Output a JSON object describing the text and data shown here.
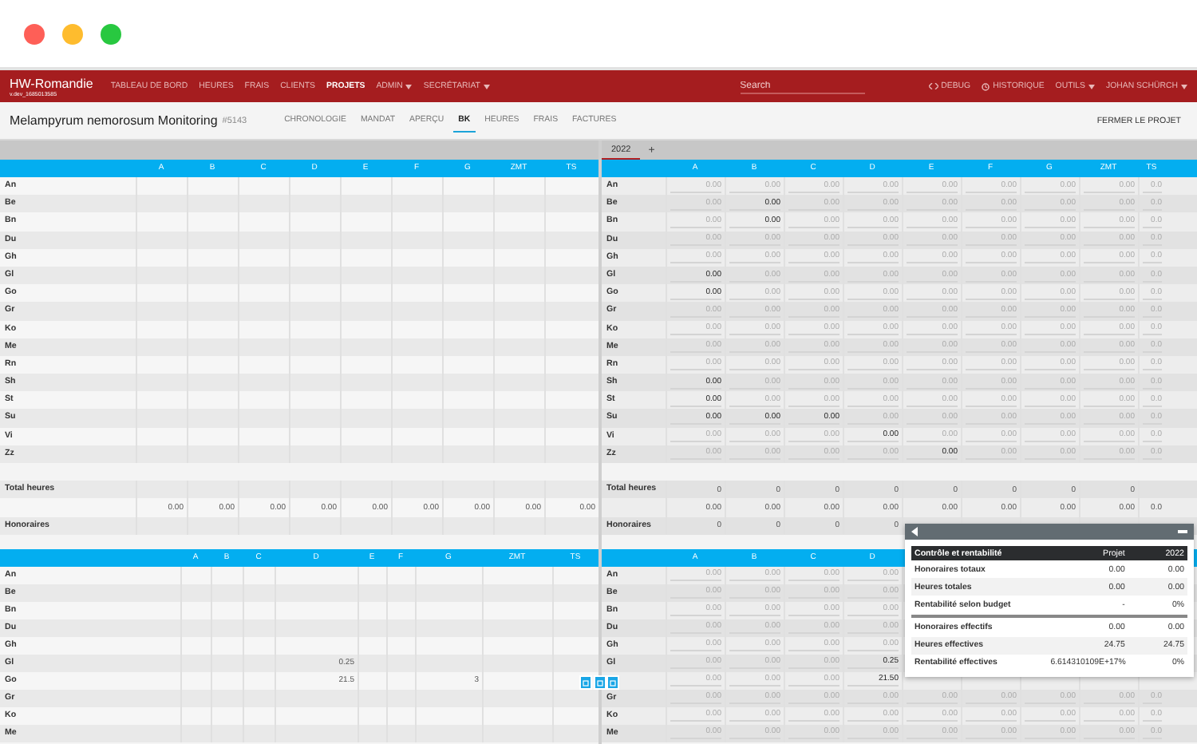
{
  "navbar": {
    "brand": "HW-Romandie",
    "version": "v.dev_1685013585",
    "items": [
      {
        "label": "TABLEAU DE BORD",
        "selected": false,
        "dropdown": false
      },
      {
        "label": "HEURES",
        "selected": false,
        "dropdown": false
      },
      {
        "label": "FRAIS",
        "selected": false,
        "dropdown": false
      },
      {
        "label": "CLIENTS",
        "selected": false,
        "dropdown": false
      },
      {
        "label": "PROJETS",
        "selected": true,
        "dropdown": false
      },
      {
        "label": "ADMIN",
        "selected": false,
        "dropdown": true
      },
      {
        "label": "SECRÉTARIAT",
        "selected": false,
        "dropdown": true
      }
    ],
    "search": {
      "placeholder": "Search"
    },
    "right_items": [
      {
        "label": "DEBUG",
        "kind": "code"
      },
      {
        "label": "HISTORIQUE",
        "kind": "history"
      },
      {
        "label": "OUTILS",
        "kind": "dropdown"
      },
      {
        "label": "JOHAN SCHÜRCH",
        "kind": "dropdown"
      }
    ]
  },
  "project": {
    "title": "Melampyrum nemorosum Monitoring",
    "number": "#5143",
    "tabs": [
      {
        "label": "CHRONOLOGIE",
        "selected": false
      },
      {
        "label": "MANDAT",
        "selected": false
      },
      {
        "label": "APERÇU",
        "selected": false
      },
      {
        "label": "BK",
        "selected": true
      },
      {
        "label": "HEURES",
        "selected": false
      },
      {
        "label": "FRAIS",
        "selected": false
      },
      {
        "label": "FACTURES",
        "selected": false
      }
    ],
    "close_button": "FERMER LE PROJET"
  },
  "left": {
    "top_table": {
      "columns": [
        "A",
        "B",
        "C",
        "D",
        "E",
        "F",
        "G",
        "ZMT",
        "TS"
      ],
      "rows": [
        {
          "kind": "plain",
          "label": "An"
        },
        {
          "kind": "plain",
          "label": "Be"
        },
        {
          "kind": "plain",
          "label": "Bn"
        },
        {
          "kind": "plain",
          "label": "Du"
        },
        {
          "kind": "plain",
          "label": "Gh"
        },
        {
          "kind": "plain",
          "label": "Gl"
        },
        {
          "kind": "plain",
          "label": "Go"
        },
        {
          "kind": "plain",
          "label": "Gr"
        },
        {
          "kind": "plain",
          "label": "Ko"
        },
        {
          "kind": "plain",
          "label": "Me"
        },
        {
          "kind": "plain",
          "label": "Rn"
        },
        {
          "kind": "plain",
          "label": "Sh"
        },
        {
          "kind": "plain",
          "label": "St"
        },
        {
          "kind": "plain",
          "label": "Su"
        },
        {
          "kind": "plain",
          "label": "Vi"
        },
        {
          "kind": "plain",
          "label": "Zz"
        },
        {
          "kind": "spacer"
        },
        {
          "kind": "plain",
          "label": "Total heures"
        },
        {
          "kind": "plain",
          "cells": [
            {
              "text": "0.00"
            },
            {
              "text": "0.00"
            },
            {
              "text": "0.00"
            },
            {
              "text": "0.00"
            },
            {
              "text": "0.00"
            },
            {
              "text": "0.00"
            },
            {
              "text": "0.00"
            },
            {
              "text": "0.00"
            },
            {
              "text": "0.00"
            }
          ]
        },
        {
          "kind": "plain",
          "label": "Honoraires"
        }
      ]
    },
    "bottom_table": {
      "columns": [
        "A",
        "B",
        "C",
        "D",
        "E",
        "F",
        "G",
        "ZMT",
        "TS"
      ],
      "rows": [
        {
          "kind": "plain",
          "label": "An"
        },
        {
          "kind": "plain",
          "label": "Be"
        },
        {
          "kind": "plain",
          "label": "Bn"
        },
        {
          "kind": "plain",
          "label": "Du"
        },
        {
          "kind": "plain",
          "label": "Gh"
        },
        {
          "kind": "plain",
          "label": "Gl",
          "cells": [
            null,
            null,
            null,
            {
              "text": "0.25"
            }
          ]
        },
        {
          "kind": "plain",
          "label": "Go",
          "cells": [
            null,
            null,
            null,
            {
              "text": "21.5"
            },
            null,
            null,
            {
              "text": "3"
            }
          ]
        },
        {
          "kind": "plain",
          "label": "Gr"
        },
        {
          "kind": "plain",
          "label": "Ko"
        },
        {
          "kind": "plain",
          "label": "Me"
        }
      ]
    }
  },
  "right": {
    "year_tabs": [
      {
        "label": "2022",
        "selected": true
      }
    ],
    "add_tab": "+",
    "top_table": {
      "columns": [
        "A",
        "B",
        "C",
        "D",
        "E",
        "F",
        "G",
        "ZMT",
        "TS"
      ],
      "rows": [
        {
          "kind": "input",
          "label": "An",
          "cells": [
            {
              "text": "0.00",
              "entered": false
            },
            {
              "text": "0.00",
              "entered": false
            },
            {
              "text": "0.00",
              "entered": false
            },
            {
              "text": "0.00",
              "entered": false
            },
            {
              "text": "0.00",
              "entered": false
            },
            {
              "text": "0.00",
              "entered": false
            },
            {
              "text": "0.00",
              "entered": false
            },
            {
              "text": "0.00",
              "entered": false
            },
            {
              "text": "0.0",
              "entered": false
            }
          ]
        },
        {
          "kind": "input",
          "label": "Be",
          "cells": [
            {
              "text": "0.00",
              "entered": false
            },
            {
              "text": "0.00",
              "entered": true
            },
            {
              "text": "0.00",
              "entered": false
            },
            {
              "text": "0.00",
              "entered": false
            },
            {
              "text": "0.00",
              "entered": false
            },
            {
              "text": "0.00",
              "entered": false
            },
            {
              "text": "0.00",
              "entered": false
            },
            {
              "text": "0.00",
              "entered": false
            },
            {
              "text": "0.0",
              "entered": false
            }
          ]
        },
        {
          "kind": "input",
          "label": "Bn",
          "cells": [
            {
              "text": "0.00",
              "entered": false
            },
            {
              "text": "0.00",
              "entered": true
            },
            {
              "text": "0.00",
              "entered": false
            },
            {
              "text": "0.00",
              "entered": false
            },
            {
              "text": "0.00",
              "entered": false
            },
            {
              "text": "0.00",
              "entered": false
            },
            {
              "text": "0.00",
              "entered": false
            },
            {
              "text": "0.00",
              "entered": false
            },
            {
              "text": "0.0",
              "entered": false
            }
          ]
        },
        {
          "kind": "input",
          "label": "Du",
          "cells": [
            {
              "text": "0.00",
              "entered": false
            },
            {
              "text": "0.00",
              "entered": false
            },
            {
              "text": "0.00",
              "entered": false
            },
            {
              "text": "0.00",
              "entered": false
            },
            {
              "text": "0.00",
              "entered": false
            },
            {
              "text": "0.00",
              "entered": false
            },
            {
              "text": "0.00",
              "entered": false
            },
            {
              "text": "0.00",
              "entered": false
            },
            {
              "text": "0.0",
              "entered": false
            }
          ]
        },
        {
          "kind": "input",
          "label": "Gh",
          "cells": [
            {
              "text": "0.00",
              "entered": false
            },
            {
              "text": "0.00",
              "entered": false
            },
            {
              "text": "0.00",
              "entered": false
            },
            {
              "text": "0.00",
              "entered": false
            },
            {
              "text": "0.00",
              "entered": false
            },
            {
              "text": "0.00",
              "entered": false
            },
            {
              "text": "0.00",
              "entered": false
            },
            {
              "text": "0.00",
              "entered": false
            },
            {
              "text": "0.0",
              "entered": false
            }
          ]
        },
        {
          "kind": "input",
          "label": "Gl",
          "cells": [
            {
              "text": "0.00",
              "entered": true
            },
            {
              "text": "0.00",
              "entered": false
            },
            {
              "text": "0.00",
              "entered": false
            },
            {
              "text": "0.00",
              "entered": false
            },
            {
              "text": "0.00",
              "entered": false
            },
            {
              "text": "0.00",
              "entered": false
            },
            {
              "text": "0.00",
              "entered": false
            },
            {
              "text": "0.00",
              "entered": false
            },
            {
              "text": "0.0",
              "entered": false
            }
          ]
        },
        {
          "kind": "input",
          "label": "Go",
          "cells": [
            {
              "text": "0.00",
              "entered": true
            },
            {
              "text": "0.00",
              "entered": false
            },
            {
              "text": "0.00",
              "entered": false
            },
            {
              "text": "0.00",
              "entered": false
            },
            {
              "text": "0.00",
              "entered": false
            },
            {
              "text": "0.00",
              "entered": false
            },
            {
              "text": "0.00",
              "entered": false
            },
            {
              "text": "0.00",
              "entered": false
            },
            {
              "text": "0.0",
              "entered": false
            }
          ]
        },
        {
          "kind": "input",
          "label": "Gr",
          "cells": [
            {
              "text": "0.00",
              "entered": false
            },
            {
              "text": "0.00",
              "entered": false
            },
            {
              "text": "0.00",
              "entered": false
            },
            {
              "text": "0.00",
              "entered": false
            },
            {
              "text": "0.00",
              "entered": false
            },
            {
              "text": "0.00",
              "entered": false
            },
            {
              "text": "0.00",
              "entered": false
            },
            {
              "text": "0.00",
              "entered": false
            },
            {
              "text": "0.0",
              "entered": false
            }
          ]
        },
        {
          "kind": "input",
          "label": "Ko",
          "cells": [
            {
              "text": "0.00",
              "entered": false
            },
            {
              "text": "0.00",
              "entered": false
            },
            {
              "text": "0.00",
              "entered": false
            },
            {
              "text": "0.00",
              "entered": false
            },
            {
              "text": "0.00",
              "entered": false
            },
            {
              "text": "0.00",
              "entered": false
            },
            {
              "text": "0.00",
              "entered": false
            },
            {
              "text": "0.00",
              "entered": false
            },
            {
              "text": "0.0",
              "entered": false
            }
          ]
        },
        {
          "kind": "input",
          "label": "Me",
          "cells": [
            {
              "text": "0.00",
              "entered": false
            },
            {
              "text": "0.00",
              "entered": false
            },
            {
              "text": "0.00",
              "entered": false
            },
            {
              "text": "0.00",
              "entered": false
            },
            {
              "text": "0.00",
              "entered": false
            },
            {
              "text": "0.00",
              "entered": false
            },
            {
              "text": "0.00",
              "entered": false
            },
            {
              "text": "0.00",
              "entered": false
            },
            {
              "text": "0.0",
              "entered": false
            }
          ]
        },
        {
          "kind": "input",
          "label": "Rn",
          "cells": [
            {
              "text": "0.00",
              "entered": false
            },
            {
              "text": "0.00",
              "entered": false
            },
            {
              "text": "0.00",
              "entered": false
            },
            {
              "text": "0.00",
              "entered": false
            },
            {
              "text": "0.00",
              "entered": false
            },
            {
              "text": "0.00",
              "entered": false
            },
            {
              "text": "0.00",
              "entered": false
            },
            {
              "text": "0.00",
              "entered": false
            },
            {
              "text": "0.0",
              "entered": false
            }
          ]
        },
        {
          "kind": "input",
          "label": "Sh",
          "cells": [
            {
              "text": "0.00",
              "entered": true
            },
            {
              "text": "0.00",
              "entered": false
            },
            {
              "text": "0.00",
              "entered": false
            },
            {
              "text": "0.00",
              "entered": false
            },
            {
              "text": "0.00",
              "entered": false
            },
            {
              "text": "0.00",
              "entered": false
            },
            {
              "text": "0.00",
              "entered": false
            },
            {
              "text": "0.00",
              "entered": false
            },
            {
              "text": "0.0",
              "entered": false
            }
          ]
        },
        {
          "kind": "input",
          "label": "St",
          "cells": [
            {
              "text": "0.00",
              "entered": true
            },
            {
              "text": "0.00",
              "entered": false
            },
            {
              "text": "0.00",
              "entered": false
            },
            {
              "text": "0.00",
              "entered": false
            },
            {
              "text": "0.00",
              "entered": false
            },
            {
              "text": "0.00",
              "entered": false
            },
            {
              "text": "0.00",
              "entered": false
            },
            {
              "text": "0.00",
              "entered": false
            },
            {
              "text": "0.0",
              "entered": false
            }
          ]
        },
        {
          "kind": "input",
          "label": "Su",
          "cells": [
            {
              "text": "0.00",
              "entered": true
            },
            {
              "text": "0.00",
              "entered": true
            },
            {
              "text": "0.00",
              "entered": true
            },
            {
              "text": "0.00",
              "entered": false
            },
            {
              "text": "0.00",
              "entered": false
            },
            {
              "text": "0.00",
              "entered": false
            },
            {
              "text": "0.00",
              "entered": false
            },
            {
              "text": "0.00",
              "entered": false
            },
            {
              "text": "0.0",
              "entered": false
            }
          ]
        },
        {
          "kind": "input",
          "label": "Vi",
          "cells": [
            {
              "text": "0.00",
              "entered": false
            },
            {
              "text": "0.00",
              "entered": false
            },
            {
              "text": "0.00",
              "entered": false
            },
            {
              "text": "0.00",
              "entered": true
            },
            {
              "text": "0.00",
              "entered": false
            },
            {
              "text": "0.00",
              "entered": false
            },
            {
              "text": "0.00",
              "entered": false
            },
            {
              "text": "0.00",
              "entered": false
            },
            {
              "text": "0.0",
              "entered": false
            }
          ]
        },
        {
          "kind": "input",
          "label": "Zz",
          "cells": [
            {
              "text": "0.00",
              "entered": false
            },
            {
              "text": "0.00",
              "entered": false
            },
            {
              "text": "0.00",
              "entered": false
            },
            {
              "text": "0.00",
              "entered": false
            },
            {
              "text": "0.00",
              "entered": true
            },
            {
              "text": "0.00",
              "entered": false
            },
            {
              "text": "0.00",
              "entered": false
            },
            {
              "text": "0.00",
              "entered": false
            },
            {
              "text": "0.0",
              "entered": false
            }
          ]
        },
        {
          "kind": "spacer"
        },
        {
          "kind": "plain",
          "label": "Total heures",
          "cells": [
            {
              "text": "0"
            },
            {
              "text": "0"
            },
            {
              "text": "0"
            },
            {
              "text": "0"
            },
            {
              "text": "0"
            },
            {
              "text": "0"
            },
            {
              "text": "0"
            },
            {
              "text": "0"
            }
          ]
        },
        {
          "kind": "plain",
          "cells": [
            {
              "text": "0.00"
            },
            {
              "text": "0.00"
            },
            {
              "text": "0.00"
            },
            {
              "text": "0.00"
            },
            {
              "text": "0.00"
            },
            {
              "text": "0.00"
            },
            {
              "text": "0.00"
            },
            {
              "text": "0.00"
            },
            {
              "text": "0.0"
            }
          ]
        },
        {
          "kind": "plain",
          "label": "Honoraires",
          "cells": [
            {
              "text": "0"
            },
            {
              "text": "0"
            },
            {
              "text": "0"
            },
            {
              "text": "0"
            }
          ]
        }
      ]
    },
    "bottom_table": {
      "columns": [
        "A",
        "B",
        "C",
        "D"
      ],
      "rows": [
        {
          "kind": "input",
          "label": "An",
          "cells": [
            {
              "text": "0.00",
              "entered": false
            },
            {
              "text": "0.00",
              "entered": false
            },
            {
              "text": "0.00",
              "entered": false
            },
            {
              "text": "0.00",
              "entered": false
            }
          ]
        },
        {
          "kind": "input",
          "label": "Be",
          "cells": [
            {
              "text": "0.00",
              "entered": false
            },
            {
              "text": "0.00",
              "entered": false
            },
            {
              "text": "0.00",
              "entered": false
            },
            {
              "text": "0.00",
              "entered": false
            }
          ]
        },
        {
          "kind": "input",
          "label": "Bn",
          "cells": [
            {
              "text": "0.00",
              "entered": false
            },
            {
              "text": "0.00",
              "entered": false
            },
            {
              "text": "0.00",
              "entered": false
            },
            {
              "text": "0.00",
              "entered": false
            }
          ]
        },
        {
          "kind": "input",
          "label": "Du",
          "cells": [
            {
              "text": "0.00",
              "entered": false
            },
            {
              "text": "0.00",
              "entered": false
            },
            {
              "text": "0.00",
              "entered": false
            },
            {
              "text": "0.00",
              "entered": false
            }
          ]
        },
        {
          "kind": "input",
          "label": "Gh",
          "cells": [
            {
              "text": "0.00",
              "entered": false
            },
            {
              "text": "0.00",
              "entered": false
            },
            {
              "text": "0.00",
              "entered": false
            },
            {
              "text": "0.00",
              "entered": false
            }
          ]
        },
        {
          "kind": "input",
          "label": "Gl",
          "cells": [
            {
              "text": "0.00",
              "entered": false
            },
            {
              "text": "0.00",
              "entered": false
            },
            {
              "text": "0.00",
              "entered": false
            },
            {
              "text": "0.25",
              "entered": true
            }
          ]
        },
        {
          "kind": "input",
          "cells": [
            {
              "text": "0.00",
              "entered": false
            },
            {
              "text": "0.00",
              "entered": false
            },
            {
              "text": "0.00",
              "entered": false
            },
            {
              "text": "21.50",
              "entered": true
            }
          ]
        },
        {
          "kind": "input",
          "label": "Gr",
          "cells": [
            {
              "text": "0.00",
              "entered": false
            },
            {
              "text": "0.00",
              "entered": false
            },
            {
              "text": "0.00",
              "entered": false
            },
            {
              "text": "0.00",
              "entered": false
            },
            {
              "text": "0.00",
              "entered": false
            },
            {
              "text": "0.00",
              "entered": false
            },
            {
              "text": "0.00",
              "entered": false
            },
            {
              "text": "0.00",
              "entered": false
            },
            {
              "text": "0.0",
              "entered": false
            }
          ]
        },
        {
          "kind": "input",
          "label": "Ko",
          "cells": [
            {
              "text": "0.00",
              "entered": false
            },
            {
              "text": "0.00",
              "entered": false
            },
            {
              "text": "0.00",
              "entered": false
            },
            {
              "text": "0.00",
              "entered": false
            },
            {
              "text": "0.00",
              "entered": false
            },
            {
              "text": "0.00",
              "entered": false
            },
            {
              "text": "0.00",
              "entered": false
            },
            {
              "text": "0.00",
              "entered": false
            },
            {
              "text": "0.0",
              "entered": false
            }
          ]
        },
        {
          "kind": "input",
          "label": "Me",
          "cells": [
            {
              "text": "0.00",
              "entered": false
            },
            {
              "text": "0.00",
              "entered": false
            },
            {
              "text": "0.00",
              "entered": false
            },
            {
              "text": "0.00",
              "entered": false
            },
            {
              "text": "0.00",
              "entered": false
            },
            {
              "text": "0.00",
              "entered": false
            },
            {
              "text": "0.00",
              "entered": false
            },
            {
              "text": "0.00",
              "entered": false
            },
            {
              "text": "0.0",
              "entered": false
            }
          ]
        }
      ]
    },
    "control_panel": {
      "headings": [
        "Contrôle et rentabilité",
        "Projet",
        "2022"
      ],
      "groups": [
        [
          {
            "label": "Honoraires totaux",
            "project": "0.00",
            "year": "0.00"
          },
          {
            "label": "Heures totales",
            "project": "0.00",
            "year": "0.00"
          },
          {
            "label": "Rentabilité selon budget",
            "project": "-",
            "year": "0%"
          }
        ],
        [
          {
            "label": "Honoraires effectifs",
            "project": "0.00",
            "year": "0.00"
          },
          {
            "label": "Heures effectives",
            "project": "24.75",
            "year": "24.75"
          },
          {
            "label": "Rentabilité effectives",
            "project": "6.614310109E+17%",
            "year": "0%"
          }
        ]
      ]
    }
  }
}
